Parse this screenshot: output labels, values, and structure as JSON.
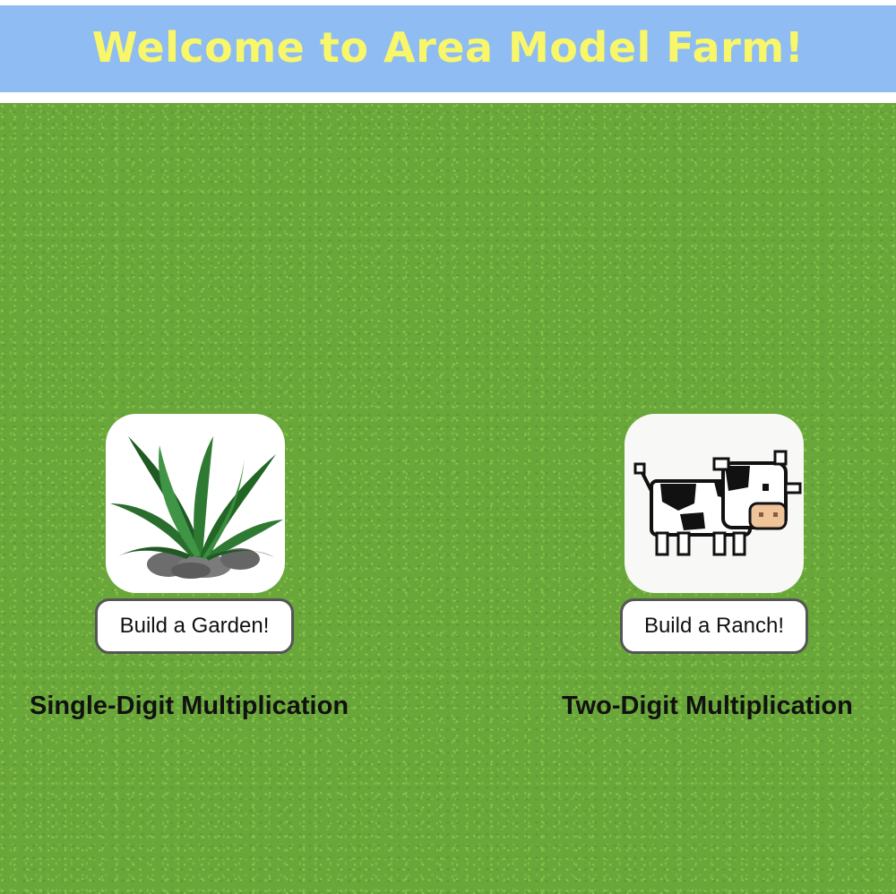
{
  "header": {
    "title": "Welcome to Area Model Farm!"
  },
  "options": [
    {
      "image_icon": "grass-plant-icon",
      "button_label": "Build a Garden!",
      "caption": "Single-Digit Multiplication"
    },
    {
      "image_icon": "cow-icon",
      "button_label": "Build a Ranch!",
      "caption": "Two-Digit Multiplication"
    }
  ],
  "colors": {
    "banner": "#8fbcf2",
    "title": "#f8f76a",
    "field": "#6aa73a"
  }
}
